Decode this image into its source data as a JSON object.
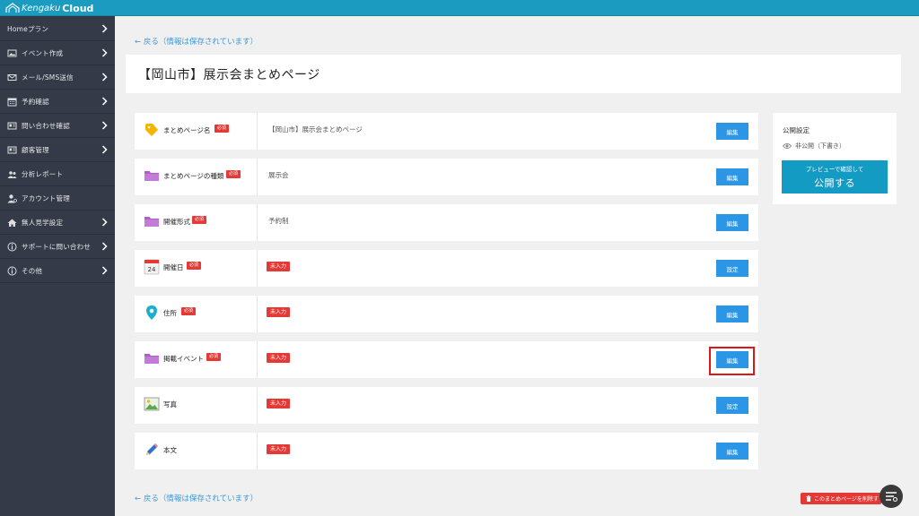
{
  "brand": {
    "name_a": "Kengaku",
    "name_b": "Cloud"
  },
  "sidebar": {
    "items": [
      {
        "label": "Homeプラン",
        "icon": "home-icon"
      },
      {
        "label": "イベント作成",
        "icon": "image-icon"
      },
      {
        "label": "メール/SMS送信",
        "icon": "mail-icon"
      },
      {
        "label": "予約確認",
        "icon": "calendar-icon"
      },
      {
        "label": "問い合わせ確認",
        "icon": "card-icon"
      },
      {
        "label": "顧客管理",
        "icon": "card-icon"
      },
      {
        "label": "分析レポート",
        "icon": "users-icon"
      },
      {
        "label": "アカウント管理",
        "icon": "user-gear-icon"
      },
      {
        "label": "無人見学設定",
        "icon": "house-icon"
      },
      {
        "label": "サポートに問い合わせ",
        "icon": "info-icon"
      },
      {
        "label": "その他",
        "icon": "info-icon"
      }
    ]
  },
  "main": {
    "back_top": "← 戻る（情報は保存されています）",
    "back_bottom": "← 戻る（情報は保存されています）",
    "page_title": "【岡山市】展示会まとめページ",
    "rows": [
      {
        "label": "まとめページ名",
        "required": "必須",
        "value": "【岡山市】展示会まとめページ",
        "empty": "",
        "button": "編集",
        "icon": "tag-icon"
      },
      {
        "label": "まとめページの種類",
        "required": "必須",
        "value": "展示会",
        "empty": "",
        "button": "編集",
        "icon": "folder-icon"
      },
      {
        "label": "開催形式",
        "required": "必須",
        "value": "予約制",
        "empty": "",
        "button": "編集",
        "icon": "folder-icon"
      },
      {
        "label": "開催日",
        "required": "必須",
        "value": "",
        "empty": "未入力",
        "button": "設定",
        "icon": "calendar-24-icon",
        "calendar_day": "24"
      },
      {
        "label": "住所",
        "required": "必須",
        "value": "",
        "empty": "未入力",
        "button": "編集",
        "icon": "map-pin-icon"
      },
      {
        "label": "掲載イベント",
        "required": "必須",
        "value": "",
        "empty": "未入力",
        "button": "編集",
        "icon": "folder-icon"
      },
      {
        "label": "写真",
        "required": "",
        "value": "",
        "empty": "未入力",
        "button": "設定",
        "icon": "photo-icon"
      },
      {
        "label": "本文",
        "required": "",
        "value": "",
        "empty": "未入力",
        "button": "編集",
        "icon": "pencil-icon"
      }
    ]
  },
  "publish": {
    "title": "公開設定",
    "status": "非公開（下書き）",
    "button_line1": "プレビューで確認して",
    "button_line2": "公開する"
  },
  "delete_button": "このまとめページを削除す",
  "colors": {
    "topbar": "#1a9bbf",
    "sidebar": "#353a48",
    "button": "#2b95e6",
    "required": "#e53935",
    "publish": "#139bc4",
    "highlight": "#e01515"
  }
}
